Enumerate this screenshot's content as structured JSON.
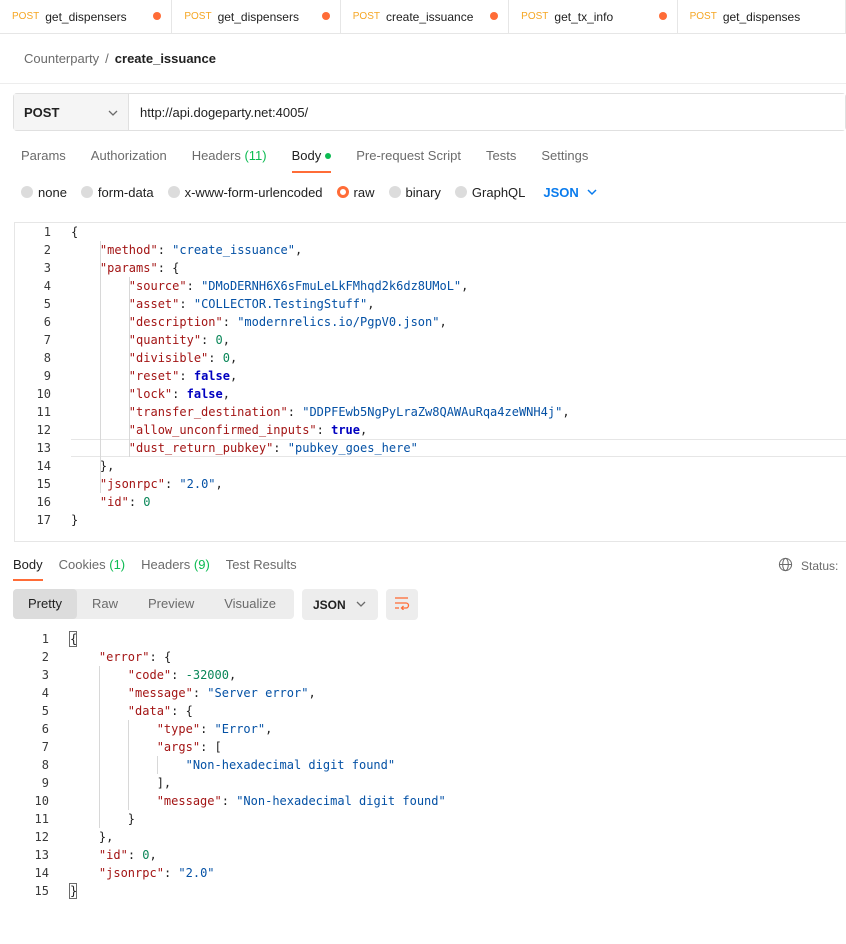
{
  "tabs": [
    {
      "method": "POST",
      "name": "get_dispensers",
      "unsaved": true
    },
    {
      "method": "POST",
      "name": "get_dispensers",
      "unsaved": true
    },
    {
      "method": "POST",
      "name": "create_issuance",
      "unsaved": true,
      "active": true
    },
    {
      "method": "POST",
      "name": "get_tx_info",
      "unsaved": true
    },
    {
      "method": "POST",
      "name": "get_dispenses",
      "unsaved": false
    }
  ],
  "breadcrumb": {
    "collection": "Counterparty",
    "separator": "/",
    "request": "create_issuance"
  },
  "request": {
    "method": "POST",
    "url": "http://api.dogeparty.net:4005/"
  },
  "request_tabs": [
    {
      "label": "Params"
    },
    {
      "label": "Authorization"
    },
    {
      "label": "Headers",
      "count": "(11)"
    },
    {
      "label": "Body",
      "active": true
    },
    {
      "label": "Pre-request Script"
    },
    {
      "label": "Tests"
    },
    {
      "label": "Settings"
    }
  ],
  "body_options": {
    "modes": [
      "none",
      "form-data",
      "x-www-form-urlencoded",
      "raw",
      "binary",
      "GraphQL"
    ],
    "selected": "raw",
    "language": "JSON"
  },
  "request_body_lines": [
    "{",
    "    \"method\": \"create_issuance\",",
    "    \"params\": {",
    "        \"source\": \"DMoDERNH6X6sFmuLeLkFMhqd2k6dz8UMoL\",",
    "        \"asset\": \"COLLECTOR.TestingStuff\",",
    "        \"description\": \"modernrelics.io/PgpV0.json\",",
    "        \"quantity\": 0,",
    "        \"divisible\": 0,",
    "        \"reset\": false,",
    "        \"lock\": false,",
    "        \"transfer_destination\": \"DDPFEwb5NgPyLraZw8QAWAuRqa4zeWNH4j\",",
    "        \"allow_unconfirmed_inputs\": true,",
    "        \"dust_return_pubkey\": \"pubkey_goes_here\"",
    "    },",
    "    \"jsonrpc\": \"2.0\",",
    "    \"id\": 0",
    "}"
  ],
  "response_tabs": [
    {
      "label": "Body",
      "active": true
    },
    {
      "label": "Cookies",
      "count": "(1)"
    },
    {
      "label": "Headers",
      "count": "(9)"
    },
    {
      "label": "Test Results"
    }
  ],
  "status_label": "Status:",
  "view_modes": [
    "Pretty",
    "Raw",
    "Preview",
    "Visualize"
  ],
  "selected_view": "Pretty",
  "response_format": "JSON",
  "response_body_lines": [
    "{",
    "    \"error\": {",
    "        \"code\": -32000,",
    "        \"message\": \"Server error\",",
    "        \"data\": {",
    "            \"type\": \"Error\",",
    "            \"args\": [",
    "                \"Non-hexadecimal digit found\"",
    "            ],",
    "            \"message\": \"Non-hexadecimal digit found\"",
    "        }",
    "    },",
    "    \"id\": 0,",
    "    \"jsonrpc\": \"2.0\"",
    "}"
  ],
  "colors": {
    "accent": "#ff6c37",
    "success": "#0cbb52",
    "link": "#097bed",
    "method": "#f5a623"
  }
}
